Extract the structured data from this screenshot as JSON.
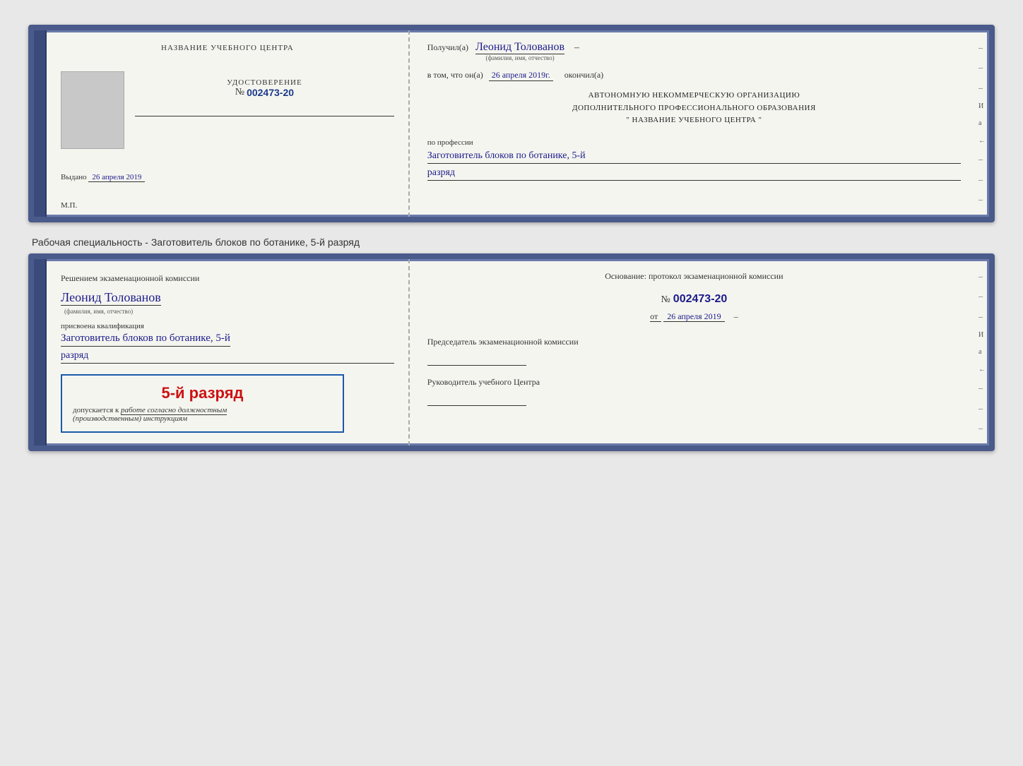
{
  "page": {
    "background_color": "#e8e8e8"
  },
  "doc1": {
    "left": {
      "title": "НАЗВАНИЕ УЧЕБНОГО ЦЕНТРА",
      "cert_label": "УДОСТОВЕРЕНИЕ",
      "cert_number_prefix": "№",
      "cert_number": "002473-20",
      "issued_label": "Выдано",
      "issued_date": "26 апреля 2019",
      "mp_label": "М.П."
    },
    "right": {
      "received_prefix": "Получил(а)",
      "recipient_name": "Леонид Толованов",
      "fio_label": "(фамилия, имя, отчество)",
      "vtom_prefix": "в том, что он(а)",
      "completion_date": "26 апреля 2019г.",
      "okoncil": "окончил(а)",
      "org_line1": "АВТОНОМНУЮ НЕКОММЕРЧЕСКУЮ ОРГАНИЗАЦИЮ",
      "org_line2": "ДОПОЛНИТЕЛЬНОГО ПРОФЕССИОНАЛЬНОГО ОБРАЗОВАНИЯ",
      "org_line3": "\"   НАЗВАНИЕ УЧЕБНОГО ЦЕНТРА   \"",
      "profession_label": "по профессии",
      "profession_name": "Заготовитель блоков по ботанике, 5-й",
      "razryad": "разряд"
    }
  },
  "specialty_label": "Рабочая специальность - Заготовитель блоков по ботанике, 5-й разряд",
  "doc2": {
    "left": {
      "commission_prefix": "Решением экзаменационной комиссии",
      "name": "Леонид Толованов",
      "fio_label": "(фамилия, имя, отчество)",
      "assigned_label": "присвоена квалификация",
      "qualification": "Заготовитель блоков по ботанике, 5-й",
      "razryad": "разряд",
      "stamp_rank": "5-й разряд",
      "allowed_prefix": "допускается к",
      "allowed_text": "работе согласно должностным",
      "instructions": "(производственным) инструкциям"
    },
    "right": {
      "basis_label": "Основание: протокол экзаменационной комиссии",
      "protocol_prefix": "№",
      "protocol_number": "002473-20",
      "date_prefix": "от",
      "protocol_date": "26 апреля 2019",
      "chairman_label": "Председатель экзаменационной комиссии",
      "director_label": "Руководитель учебного Центра"
    }
  },
  "edge": {
    "text_i": "И",
    "text_a": "а",
    "text_arrow": "←",
    "dashes": [
      "–",
      "–",
      "–",
      "–",
      "–",
      "–",
      "–"
    ]
  }
}
